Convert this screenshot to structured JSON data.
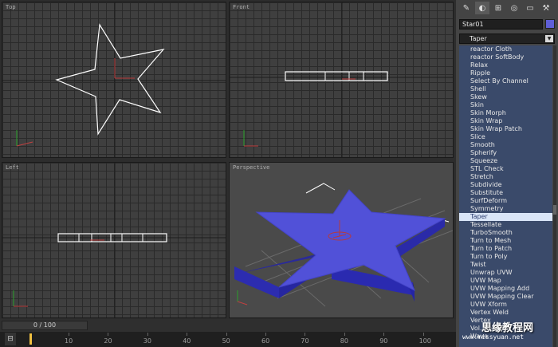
{
  "viewports": {
    "top": "Top",
    "front": "Front",
    "left": "Left",
    "perspective": "Perspective"
  },
  "command_panel": {
    "object_name": "Star01",
    "object_color": "#5f5fd7",
    "modifier_dropdown": "Taper",
    "modifiers": [
      "reactor Cloth",
      "reactor SoftBody",
      "Relax",
      "Ripple",
      "Select By Channel",
      "Shell",
      "Skew",
      "Skin",
      "Skin Morph",
      "Skin Wrap",
      "Skin Wrap Patch",
      "Slice",
      "Smooth",
      "Spherify",
      "Squeeze",
      "STL Check",
      "Stretch",
      "Subdivide",
      "Substitute",
      "SurfDeform",
      "Symmetry",
      "Taper",
      "Tessellate",
      "TurboSmooth",
      "Turn to Mesh",
      "Turn to Patch",
      "Turn to Poly",
      "Twist",
      "Unwrap UVW",
      "UVW Map",
      "UVW Mapping Add",
      "UVW Mapping Clear",
      "UVW Xform",
      "Vertex Weld",
      "Vertex",
      "Vol. Select",
      "Wave"
    ],
    "selected_index": 21
  },
  "timeline": {
    "frame_counter": "0 / 100",
    "ticks": [
      "10",
      "20",
      "30",
      "40",
      "50",
      "60",
      "70",
      "80",
      "90",
      "100"
    ]
  },
  "watermark": {
    "cn": "思缘教程网",
    "url": "www.missyuan.net"
  }
}
